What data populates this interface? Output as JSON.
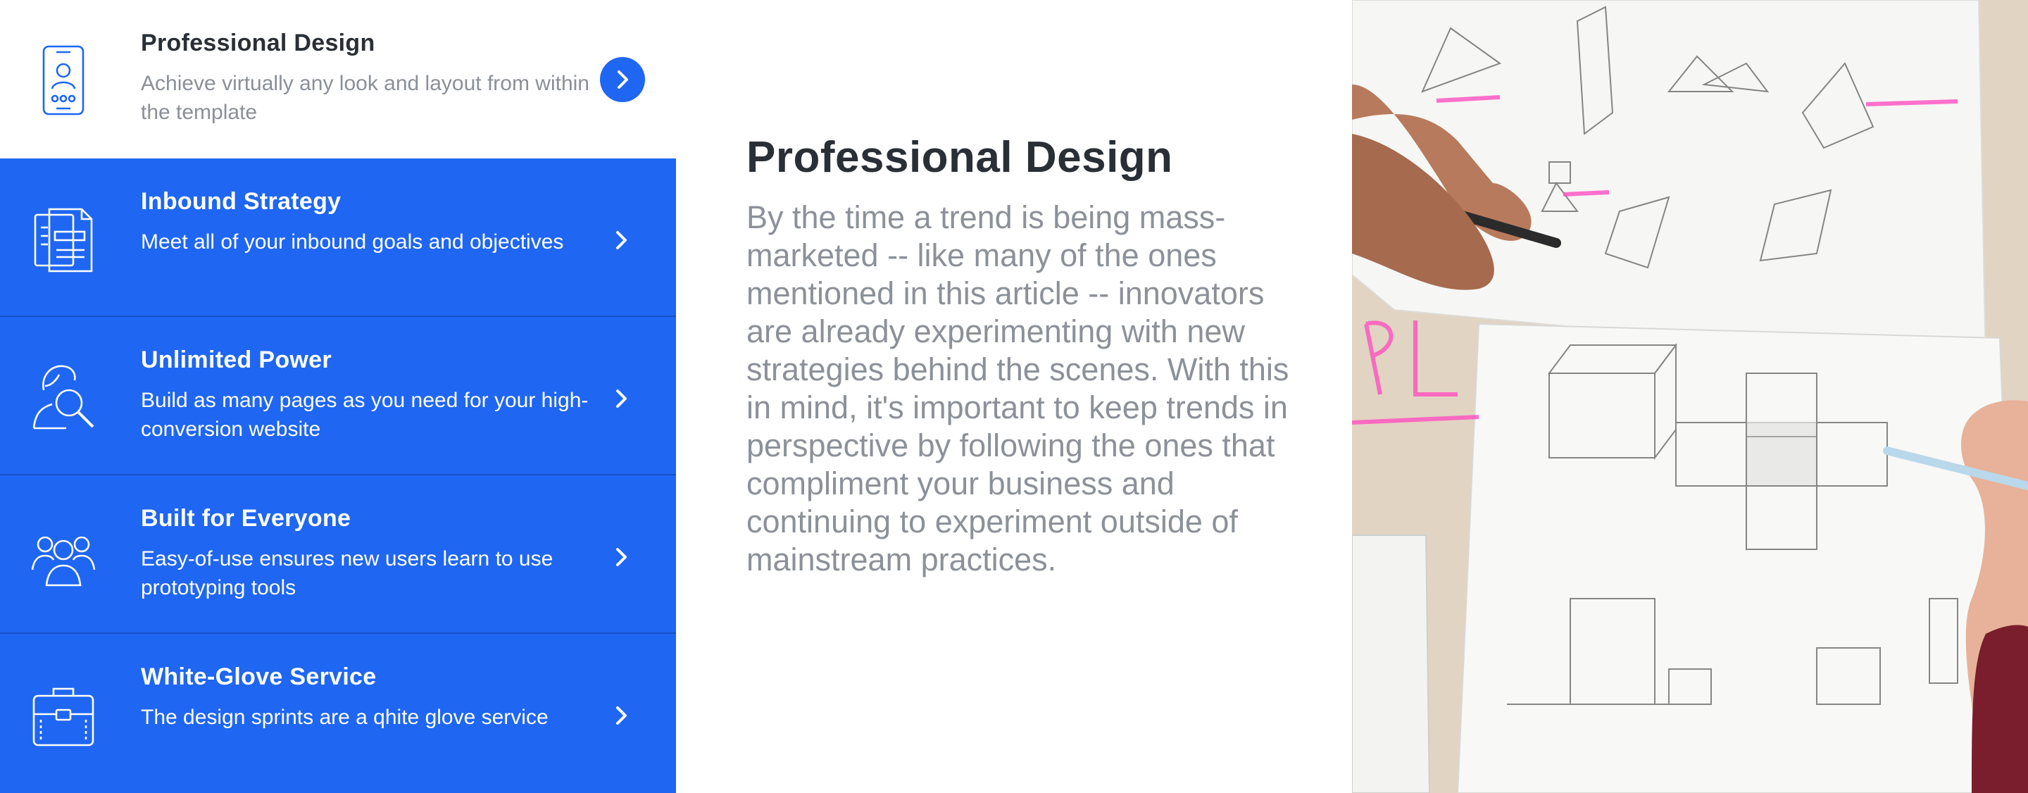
{
  "tabs": [
    {
      "title": "Professional Design",
      "description": "Achieve virtually any look and layout from within the template",
      "icon": "smartphone-user-icon",
      "active": true
    },
    {
      "title": "Inbound Strategy",
      "description": "Meet all of your inbound goals and objectives",
      "icon": "documents-icon",
      "active": false
    },
    {
      "title": "Unlimited Power",
      "description": "Build as many pages as you need for your high-conversion website",
      "icon": "user-search-icon",
      "active": false
    },
    {
      "title": "Built for Everyone",
      "description": "Easy-of-use ensures new users learn to use prototyping tools",
      "icon": "user-group-icon",
      "active": false
    },
    {
      "title": "White-Glove Service",
      "description": "The design sprints are a qhite glove service",
      "icon": "briefcase-icon",
      "active": false
    }
  ],
  "content": {
    "heading": "Professional Design",
    "body": "By the time a trend is being mass-marketed -- like many of the ones mentioned in this article -- innovators are already experimenting with new strategies behind the scenes. With this in mind, it's important to keep trends in perspective by following the ones that compliment your business and continuing to experiment outside of mainstream practices."
  },
  "photo": {
    "subject": "hands sketching geometric shapes and cubes on paper"
  },
  "colors": {
    "accent": "#1f66f2",
    "heading": "#2a2f36",
    "muted": "#8a8f98"
  }
}
